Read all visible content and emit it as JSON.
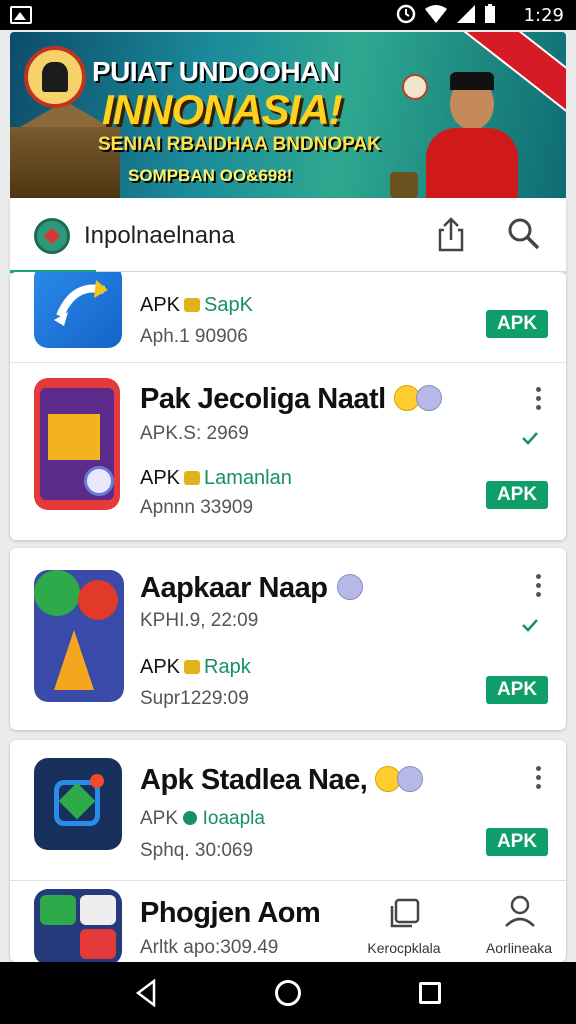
{
  "status_bar": {
    "time": "1:29"
  },
  "banner": {
    "title": "PUIAT UNDOOHAN",
    "headline": "INNONASIA!",
    "subtitle": "SENIAI RBAIDHAA BNDNOPAK",
    "subtitle2": "SOMPBAN OO&698!"
  },
  "appbar": {
    "title": "Inpolnaelnana"
  },
  "apps": [
    {
      "name": "",
      "meta": "Aph.1 90906",
      "tag_prefix": "APK",
      "tag_green": "SapK",
      "button": "APK"
    },
    {
      "name": "Pak Jecoliga Naatl",
      "meta": "APK.S: 2969",
      "tag_prefix": "APK",
      "tag_green": "Lamanlan",
      "meta2": "Apnnn 33909",
      "button": "APK"
    },
    {
      "name": "Aapkaar Naap",
      "meta": "KPHI.9, 22:09",
      "tag_prefix": "APK",
      "tag_green": "Rapk",
      "meta2": "Supr1229:09",
      "button": "APK"
    },
    {
      "name": "Apk  Stadlea Nae,",
      "meta_prefix": "APK",
      "meta_green": "Ioaapla",
      "meta2": "Sphq. 30:069",
      "button": "APK"
    },
    {
      "name": "Phogjen Aom",
      "meta": "Arltk apo:309.49"
    }
  ],
  "bottom_nav": [
    {
      "label": "Kerocpklala",
      "icon": "copy-icon"
    },
    {
      "label": "Aorlineaka",
      "icon": "profile-icon"
    }
  ],
  "colors": {
    "accent": "#0f9d6a",
    "brand": "#1aa87a"
  }
}
